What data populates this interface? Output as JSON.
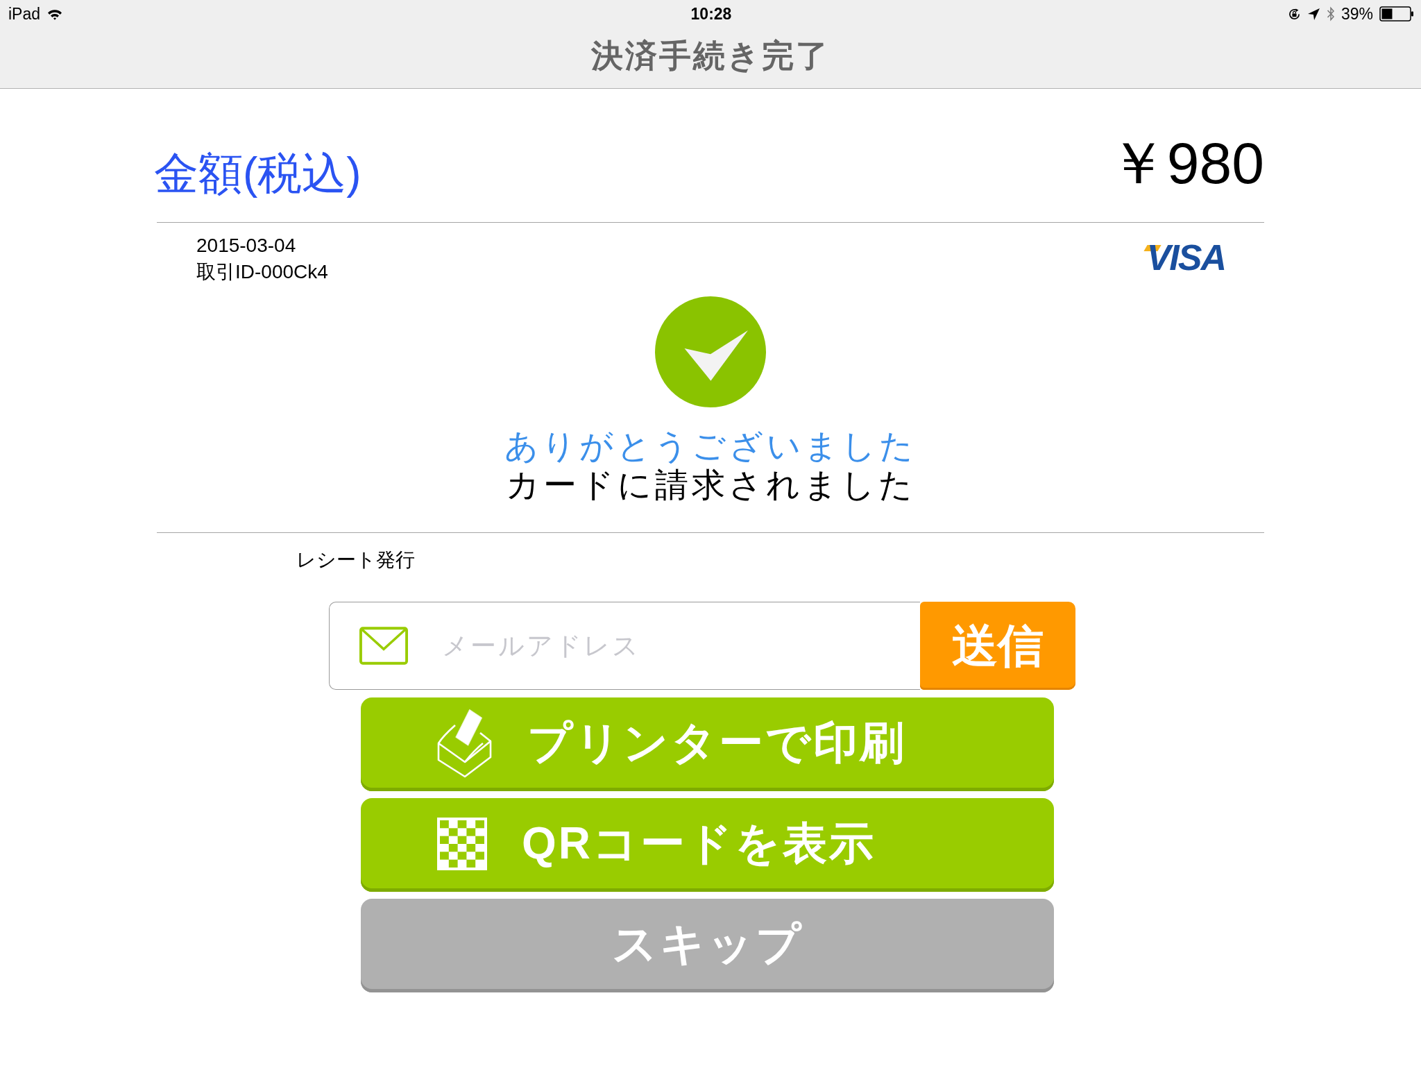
{
  "status_bar": {
    "device": "iPad",
    "time": "10:28",
    "battery": "39%"
  },
  "nav_bar": {
    "title": "決済手続き完了"
  },
  "amount": {
    "label": "金額(税込)",
    "value": "￥980"
  },
  "transaction": {
    "date": "2015-03-04",
    "id": "取引ID-000Ck4",
    "card_brand": "VISA"
  },
  "result": {
    "title": "ありがとうございました",
    "message": "カードに請求されました"
  },
  "receipt": {
    "label": "レシート発行",
    "email": {
      "placeholder": "メールアドレス"
    },
    "send_button": "送信"
  },
  "actions": [
    {
      "kind": "print",
      "label": "プリンターで印刷"
    },
    {
      "kind": "qr",
      "label": "QRコードを表示"
    },
    {
      "kind": "skip",
      "label": "スキップ"
    }
  ]
}
